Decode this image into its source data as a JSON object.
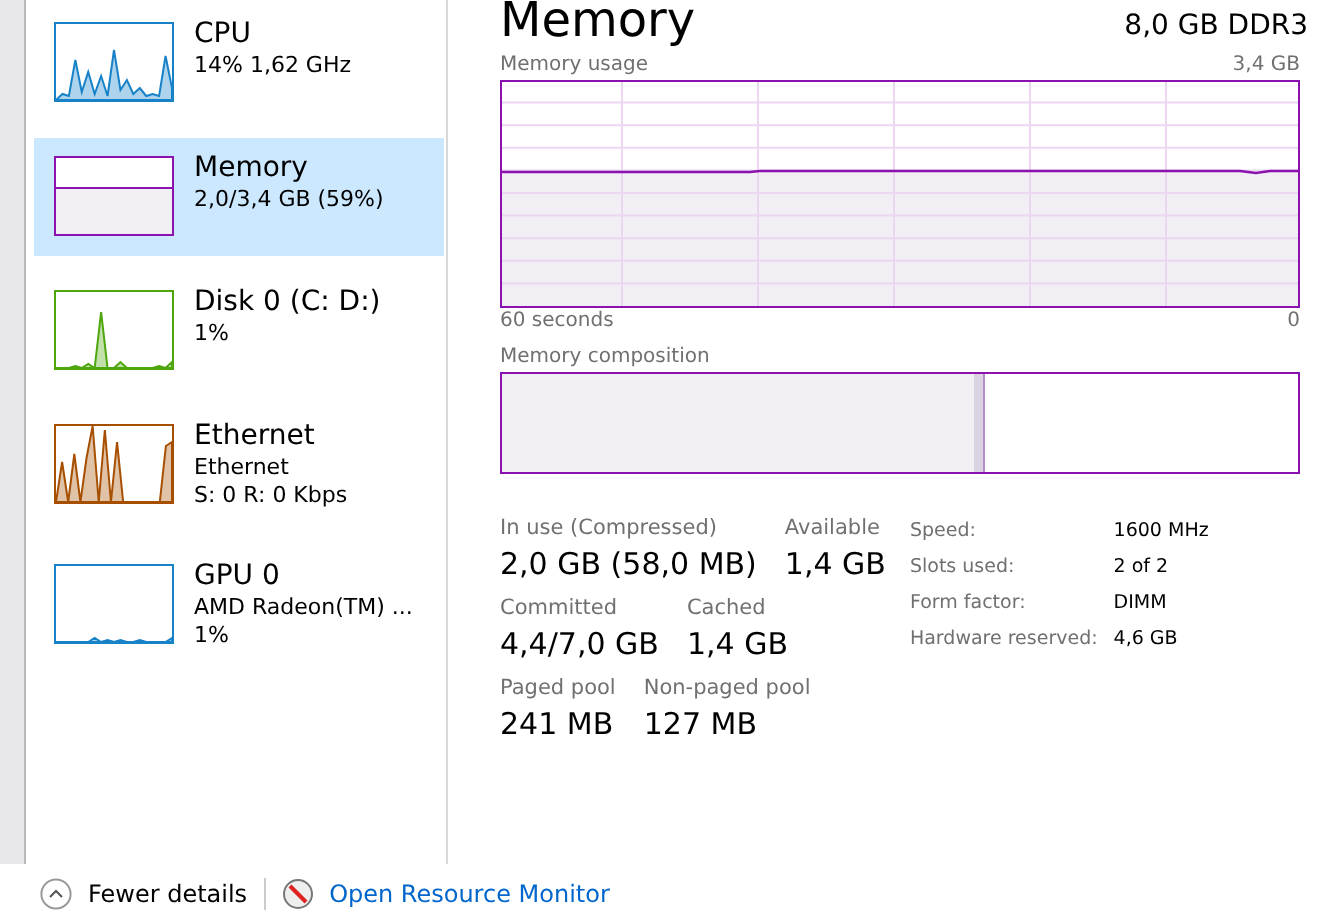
{
  "sidebar": {
    "items": [
      {
        "title": "CPU",
        "lines": [
          "14%  1,62 GHz"
        ],
        "selected": false,
        "kind": "spikes",
        "color": "#1782c8"
      },
      {
        "title": "Memory",
        "lines": [
          "2,0/3,4 GB (59%)"
        ],
        "selected": true,
        "kind": "fill",
        "color": "#8b12ae"
      },
      {
        "title": "Disk 0 (C: D:)",
        "lines": [
          "1%"
        ],
        "selected": false,
        "kind": "spikes",
        "color": "#4da60c"
      },
      {
        "title": "Ethernet",
        "lines": [
          "Ethernet",
          "S: 0 R: 0 Kbps"
        ],
        "selected": false,
        "kind": "spikes",
        "color": "#a74f01"
      },
      {
        "title": "GPU 0",
        "lines": [
          "AMD Radeon(TM) ...",
          "1%"
        ],
        "selected": false,
        "kind": "spikes",
        "color": "#1782c8"
      }
    ]
  },
  "header": {
    "title": "Memory",
    "subtitle": "8,0 GB DDR3"
  },
  "usage_graph": {
    "label": "Memory usage",
    "max": "3,4 GB",
    "time": "60 seconds",
    "min": "0"
  },
  "composition": {
    "label": "Memory composition"
  },
  "stats": [
    [
      {
        "label": "In use (Compressed)",
        "value": "2,0 GB (58,0 MB)"
      },
      {
        "label": "Available",
        "value": "1,4 GB"
      }
    ],
    [
      {
        "label": "Committed",
        "value": "4,4/7,0 GB"
      },
      {
        "label": "Cached",
        "value": "1,4 GB"
      }
    ],
    [
      {
        "label": "Paged pool",
        "value": "241 MB"
      },
      {
        "label": "Non-paged pool",
        "value": "127 MB"
      }
    ]
  ],
  "specs": [
    {
      "label": "Speed:",
      "value": "1600 MHz"
    },
    {
      "label": "Slots used:",
      "value": "2 of 2"
    },
    {
      "label": "Form factor:",
      "value": "DIMM"
    },
    {
      "label": "Hardware reserved:",
      "value": "4,6 GB"
    }
  ],
  "footer": {
    "details": "Fewer details",
    "monitor": "Open Resource Monitor"
  }
}
